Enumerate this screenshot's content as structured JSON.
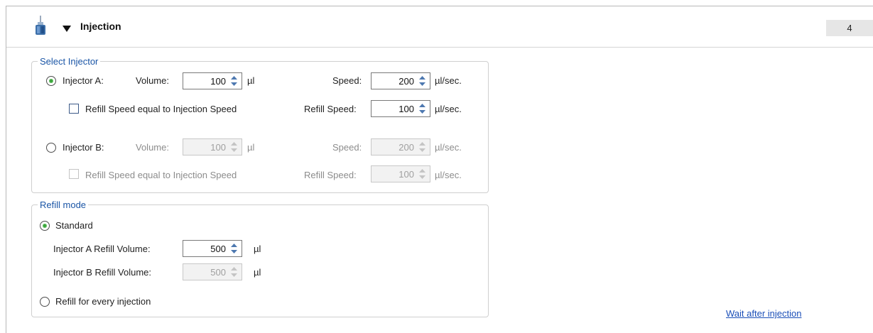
{
  "header": {
    "title": "Injection",
    "step_number": "4",
    "icon": "syringe-icon",
    "collapse_icon": "triangle-down-icon"
  },
  "select_injector": {
    "legend": "Select Injector",
    "injector_a": {
      "label": "Injector A:",
      "selected": true,
      "volume_label": "Volume:",
      "volume_value": "100",
      "volume_unit": "µl",
      "speed_label": "Speed:",
      "speed_value": "200",
      "speed_unit": "µl/sec.",
      "refill_equal_label": "Refill Speed equal to Injection Speed",
      "refill_equal_checked": false,
      "refill_speed_label": "Refill Speed:",
      "refill_speed_value": "100",
      "refill_speed_unit": "µl/sec."
    },
    "injector_b": {
      "label": "Injector B:",
      "selected": false,
      "volume_label": "Volume:",
      "volume_value": "100",
      "volume_unit": "µl",
      "speed_label": "Speed:",
      "speed_value": "200",
      "speed_unit": "µl/sec.",
      "refill_equal_label": "Refill Speed equal to Injection Speed",
      "refill_equal_checked": false,
      "refill_speed_label": "Refill Speed:",
      "refill_speed_value": "100",
      "refill_speed_unit": "µl/sec."
    }
  },
  "refill_mode": {
    "legend": "Refill mode",
    "standard_label": "Standard",
    "standard_selected": true,
    "injector_a_refill_label": "Injector A Refill Volume:",
    "injector_a_refill_value": "500",
    "injector_a_refill_unit": "µl",
    "injector_b_refill_label": "Injector B Refill Volume:",
    "injector_b_refill_value": "500",
    "injector_b_refill_unit": "µl",
    "every_injection_label": "Refill for every injection",
    "every_injection_selected": false
  },
  "wait_after_injection_link": "Wait after injection",
  "colors": {
    "legend": "#1a55a6",
    "link": "#1b4fb8",
    "radio_selected": "#3aa53a",
    "disabled_text": "#8c8c8c"
  }
}
